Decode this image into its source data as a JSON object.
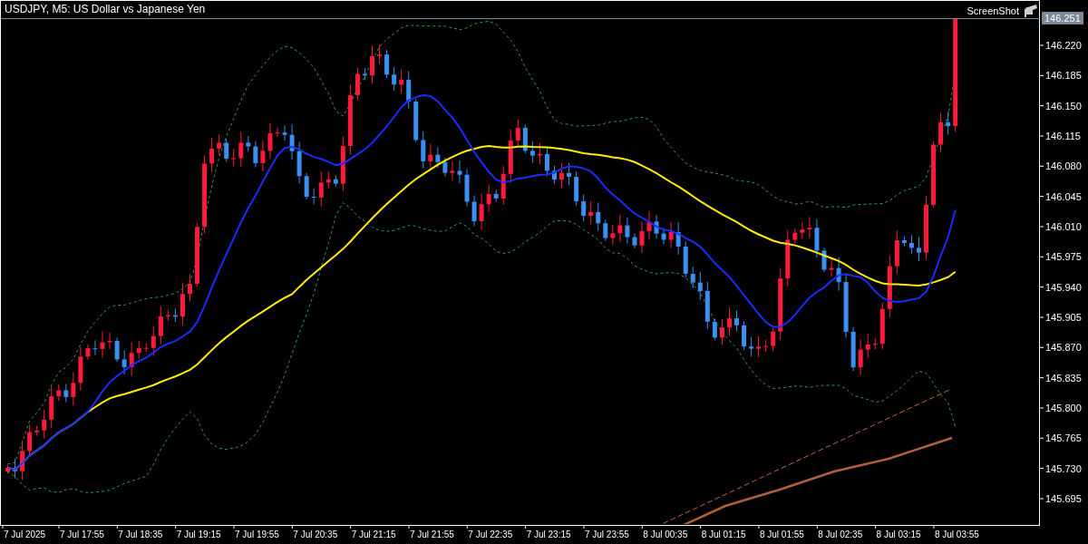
{
  "window": {
    "title": "USDJPY, M5:  US Dollar vs Japanese Yen",
    "screenshot_label": "ScreenShot"
  },
  "price_axis": {
    "labels": [
      "146.220",
      "146.185",
      "146.150",
      "146.115",
      "146.080",
      "146.045",
      "146.010",
      "145.975",
      "145.940",
      "145.905",
      "145.870",
      "145.835",
      "145.800",
      "145.765",
      "145.730",
      "145.695"
    ],
    "current_price": "146.251"
  },
  "time_axis": {
    "labels": [
      "7 Jul 2025",
      "7 Jul 17:55",
      "7 Jul 18:35",
      "7 Jul 19:15",
      "7 Jul 19:55",
      "7 Jul 20:35",
      "7 Jul 21:15",
      "7 Jul 21:55",
      "7 Jul 22:35",
      "7 Jul 23:15",
      "7 Jul 23:55",
      "8 Jul 00:35",
      "8 Jul 01:15",
      "8 Jul 01:55",
      "8 Jul 02:35",
      "8 Jul 03:15",
      "8 Jul 03:55"
    ]
  }
}
